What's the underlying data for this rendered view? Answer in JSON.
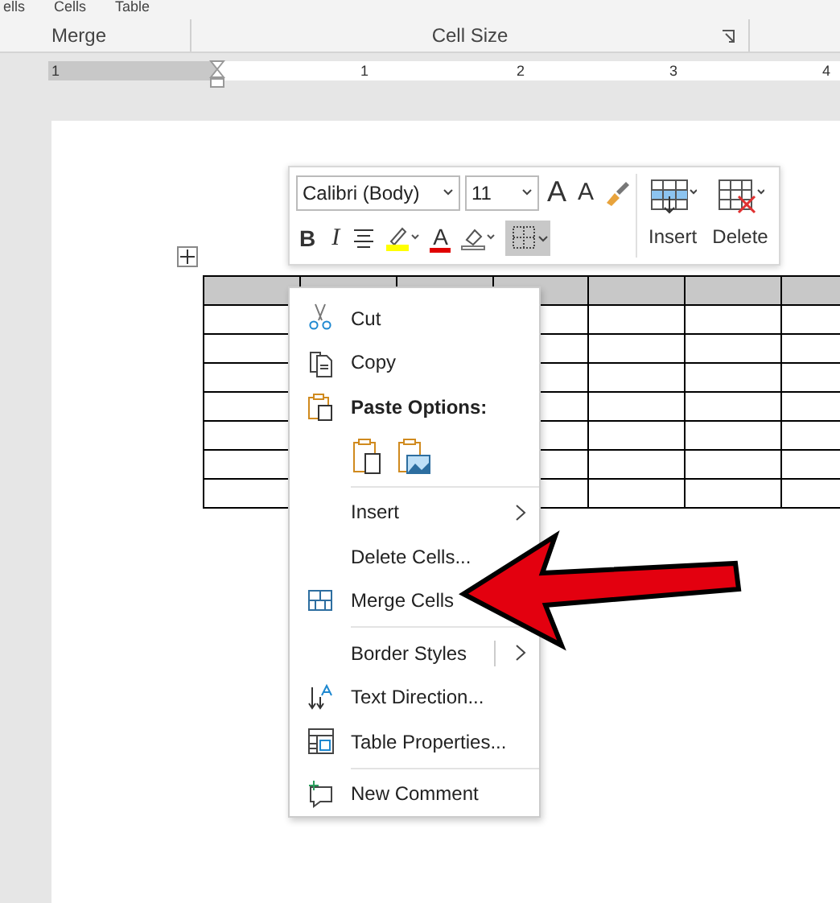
{
  "ribbon": {
    "top_labels": [
      "ells",
      "Cells",
      "Table"
    ],
    "groups": [
      {
        "label": "Merge"
      },
      {
        "label": "Cell Size"
      }
    ]
  },
  "ruler": {
    "numbers": [
      "1",
      "1",
      "2",
      "3",
      "4"
    ]
  },
  "mini_toolbar": {
    "font": "Calibri (Body)",
    "size": "11",
    "grow_font": "A",
    "shrink_font": "A",
    "bold": "B",
    "italic": "I",
    "font_color": "A",
    "borders_selected": true,
    "insert": "Insert",
    "delete": "Delete"
  },
  "context_menu": {
    "items": [
      {
        "kind": "command",
        "label": "Cut",
        "submenu": false
      },
      {
        "kind": "command",
        "label": "Copy",
        "submenu": false
      },
      {
        "kind": "header",
        "label": "Paste Options:"
      },
      {
        "kind": "paste-icons"
      },
      {
        "kind": "separator"
      },
      {
        "kind": "command",
        "label": "Insert",
        "submenu": true
      },
      {
        "kind": "command",
        "label": "Delete Cells...",
        "submenu": false
      },
      {
        "kind": "command",
        "label": "Merge Cells",
        "submenu": false
      },
      {
        "kind": "separator"
      },
      {
        "kind": "command",
        "label": "Border Styles",
        "submenu": true,
        "split": true
      },
      {
        "kind": "command",
        "label": "Text Direction...",
        "submenu": false
      },
      {
        "kind": "command",
        "label": "Table Properties...",
        "submenu": false
      },
      {
        "kind": "separator"
      },
      {
        "kind": "command",
        "label": "New Comment",
        "submenu": false
      }
    ]
  }
}
